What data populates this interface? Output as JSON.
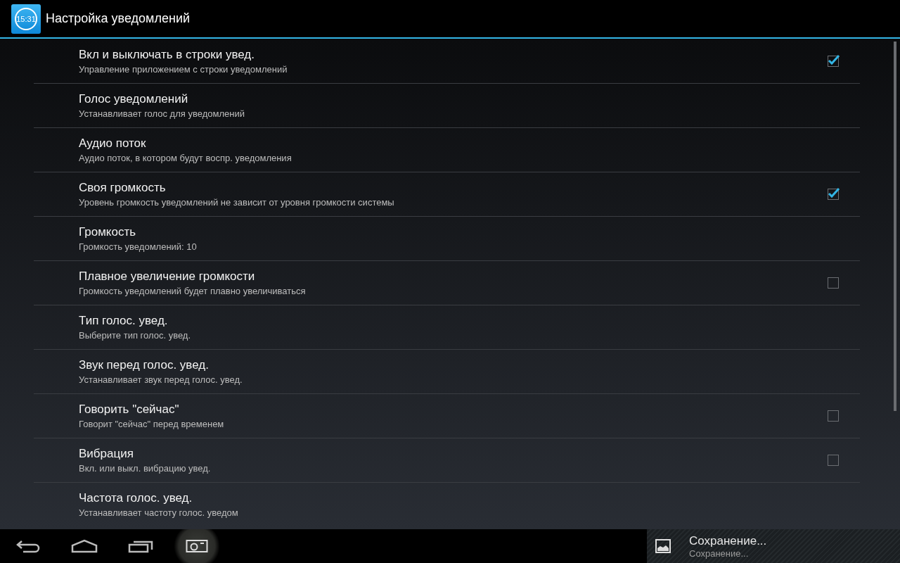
{
  "action_bar": {
    "clock_icon_text": "15:31",
    "title": "Настройка уведомлений"
  },
  "settings": [
    {
      "kind": "checkbox",
      "title": "Вкл и выключать в строки увед.",
      "summary": "Управление приложением с строки уведомлений",
      "checked": true
    },
    {
      "kind": "plain",
      "title": "Голос уведомлений",
      "summary": "Устанавливает голос для уведомлений"
    },
    {
      "kind": "plain",
      "title": "Аудио поток",
      "summary": "Аудио поток, в котором будут воспр. уведомления"
    },
    {
      "kind": "checkbox",
      "title": "Своя громкость",
      "summary": "Уровень громкость уведомлений не зависит от уровня громкости системы",
      "checked": true
    },
    {
      "kind": "plain",
      "title": "Громкость",
      "summary": "Громкость уведомлений: 10"
    },
    {
      "kind": "checkbox",
      "title": "Плавное увеличение громкости",
      "summary": "Громкость уведомлений будет плавно увеличиваться",
      "checked": false
    },
    {
      "kind": "plain",
      "title": "Тип голос. увед.",
      "summary": "Выберите тип голос. увед."
    },
    {
      "kind": "plain",
      "title": "Звук перед голос. увед.",
      "summary": "Устанавливает звук перед голос. увед."
    },
    {
      "kind": "checkbox",
      "title": "Говорить \"сейчас\"",
      "summary": "Говорит \"сейчас\" перед временем",
      "checked": false
    },
    {
      "kind": "checkbox",
      "title": "Вибрация",
      "summary": "Вкл. или выкл. вибрацию увед.",
      "checked": false
    },
    {
      "kind": "plain",
      "title": "Частота голос. увед.",
      "summary": "Устанавливает частоту голос. уведом"
    }
  ],
  "notification": {
    "title": "Сохранение...",
    "text": "Сохранение..."
  }
}
